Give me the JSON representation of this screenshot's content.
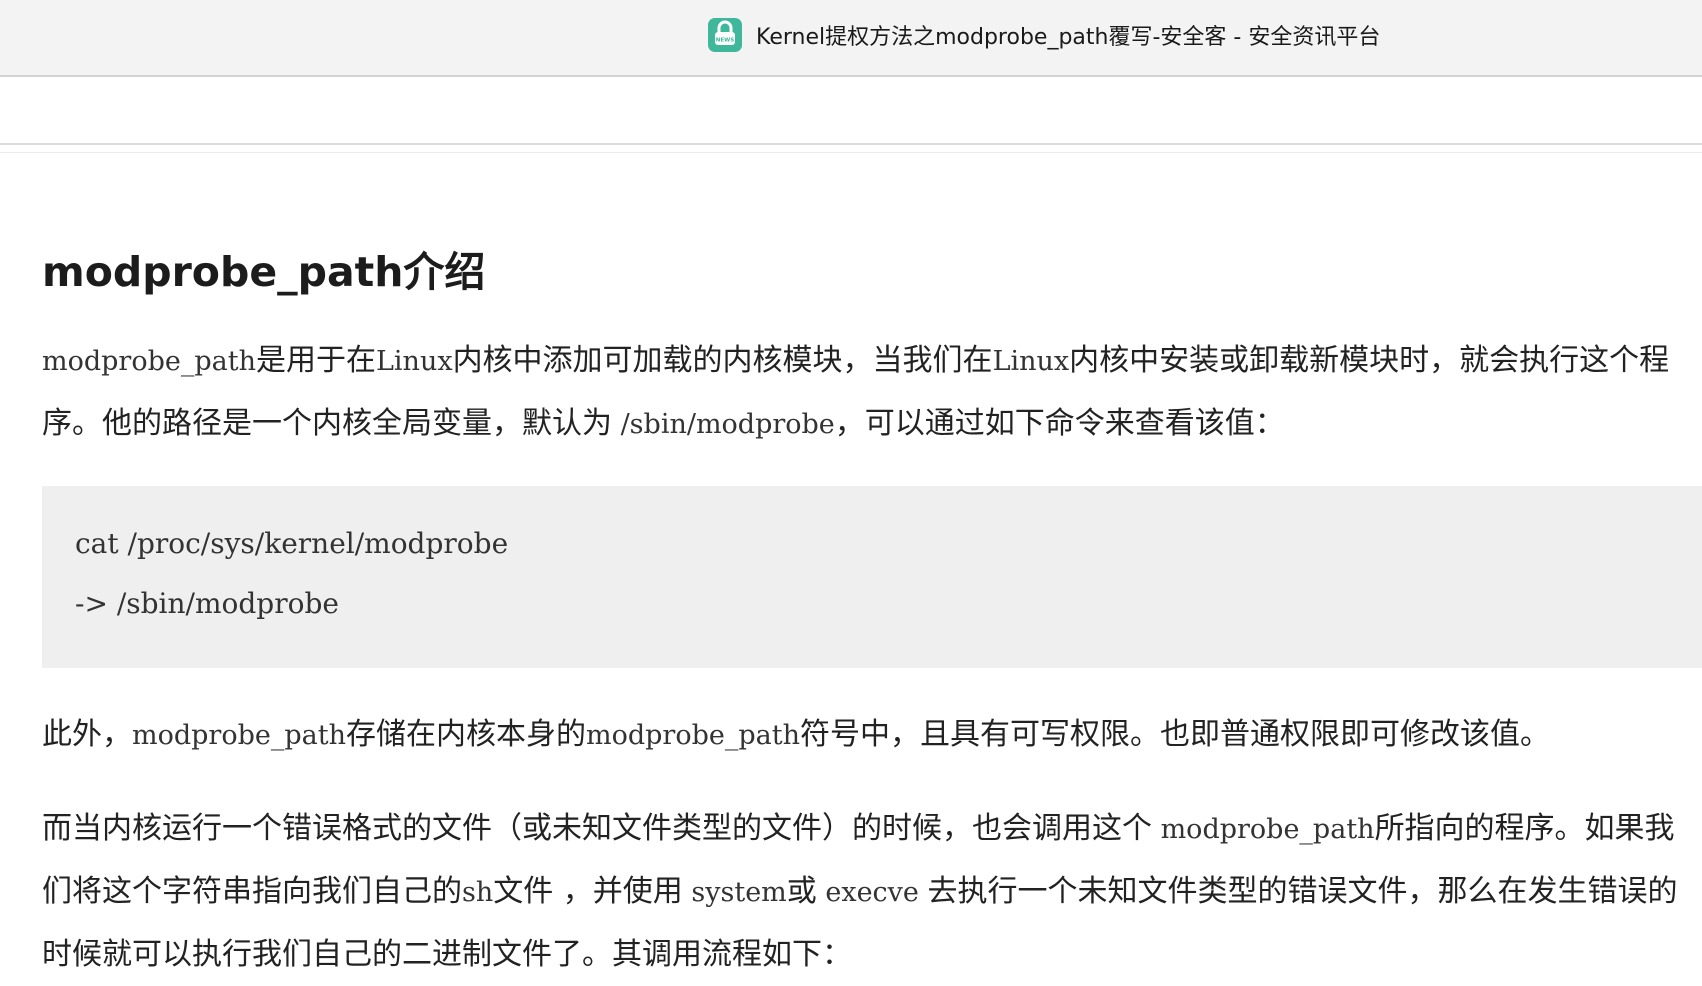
{
  "window": {
    "tab_title": "Kernel提权方法之modprobe_path覆写-安全客 - 安全资讯平台",
    "favicon": "news-icon",
    "accent_color": "#3fb79a"
  },
  "article": {
    "heading": "modprobe_path介绍",
    "p1": {
      "a": "modprobe_path",
      "b": "是用于在",
      "c": "Linux",
      "d": "内核中添加可加载的内核模块，当我们在",
      "e": "Linux",
      "f": "内核中安装或卸载新模块时，就会执行这个程序。他的路径是一个内核全局变量，默认为",
      "g": " /sbin/modprobe",
      "h": "，可以通过如下命令来查看该值："
    },
    "code": {
      "line1": "cat /proc/sys/kernel/modprobe",
      "line2": "-> /sbin/modprobe"
    },
    "p2": {
      "a": "此外，",
      "b": "modprobe_path",
      "c": "存储在内核本身的",
      "d": "modprobe_path",
      "e": "符号中，且具有可写权限。也即普通权限即可修改该值。"
    },
    "p3": {
      "a": "而当内核运行一个错误格式的文件（或未知文件类型的文件）的时候，也会调用这个",
      "b": " modprobe_path",
      "c": "所指向的程序。如果我们将这个字符串指向我们自己的",
      "d": "sh",
      "e": "文件 ，并使用",
      "f": " system",
      "g": "或",
      "h": " execve ",
      "i": "去执行一个未知文件类型的错误文件，那么在发生错误的时候就可以执行我们自己的二进制文件了。其调用流程如下："
    }
  }
}
